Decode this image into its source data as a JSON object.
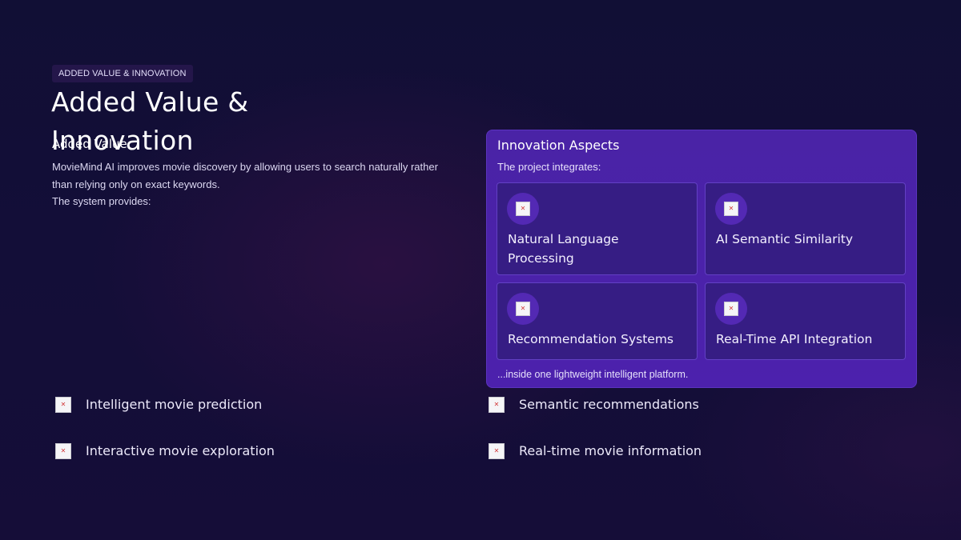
{
  "slide": {
    "badge": "ADDED VALUE & INNOVATION",
    "title": "Added Value & Innovation",
    "subheading": "Added Value",
    "body": {
      "paragraph": "MovieMind AI improves movie discovery by allowing users to search naturally rather than relying only on exact keywords.",
      "provides": "The system provides:"
    },
    "panel": {
      "title": "Innovation Aspects",
      "intro": "The project integrates:",
      "cards": [
        {
          "label": "Natural Language Processing",
          "icon": "broken-image-icon"
        },
        {
          "label": "AI Semantic Similarity",
          "icon": "broken-image-icon"
        },
        {
          "label": "Recommendation Systems",
          "icon": "broken-image-icon"
        },
        {
          "label": "Real-Time API Integration",
          "icon": "broken-image-icon"
        }
      ],
      "outro": "...inside one lightweight intelligent platform."
    },
    "features": [
      {
        "label": "Intelligent movie prediction",
        "icon": "broken-image-icon"
      },
      {
        "label": "Semantic recommendations",
        "icon": "broken-image-icon"
      },
      {
        "label": "Interactive movie exploration",
        "icon": "broken-image-icon"
      },
      {
        "label": "Real-time movie information",
        "icon": "broken-image-icon"
      }
    ],
    "colors": {
      "background": "#120f37",
      "panel": "#4a23a6",
      "card": "#361d84",
      "badge": "#24164a"
    }
  }
}
